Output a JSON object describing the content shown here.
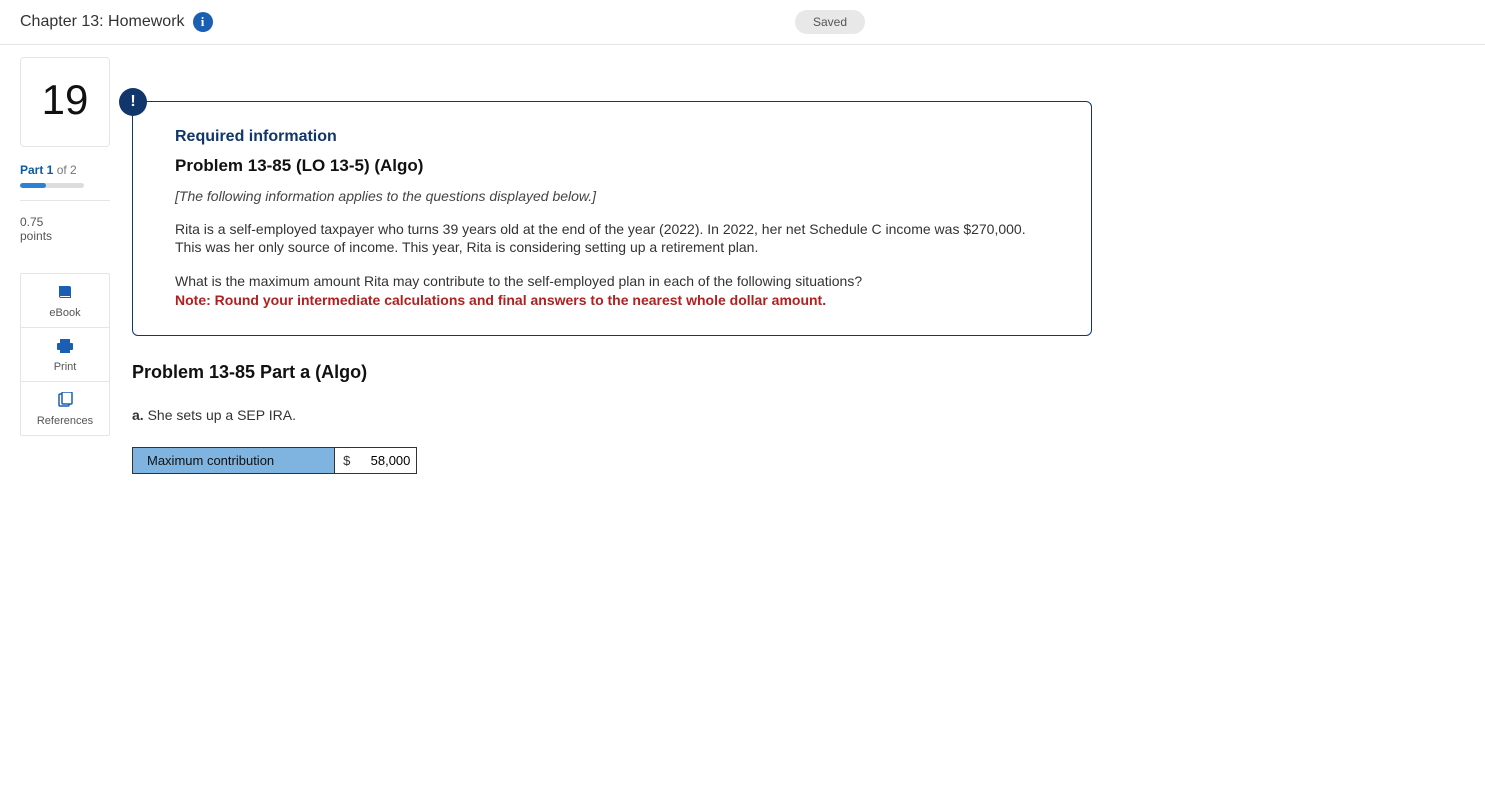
{
  "header": {
    "title": "Chapter 13: Homework",
    "info_glyph": "i",
    "saved_label": "Saved"
  },
  "sidebar": {
    "question_number": "19",
    "part_bold": "Part 1",
    "part_of": " of 2",
    "points_value": "0.75",
    "points_label": "points",
    "tools": {
      "ebook": "eBook",
      "print": "Print",
      "references": "References"
    }
  },
  "required": {
    "excl_glyph": "!",
    "heading": "Required information",
    "problem_ref": "Problem 13-85 (LO 13-5) (Algo)",
    "applies": "[The following information applies to the questions displayed below.]",
    "scenario": "Rita is a self-employed taxpayer who turns 39 years old at the end of the year (2022). In 2022, her net Schedule C income was $270,000. This was her only source of income. This year, Rita is considering setting up a retirement plan.",
    "question": "What is the maximum amount Rita may contribute to the self-employed plan in each of the following situations?",
    "note": "Note: Round your intermediate calculations and final answers to the nearest whole dollar amount."
  },
  "part": {
    "title": "Problem 13-85 Part a (Algo)",
    "sub_letter": "a.",
    "sub_text": " She sets up a SEP IRA."
  },
  "answer": {
    "row_label": "Maximum contribution",
    "currency": "$",
    "value": "58,000"
  }
}
